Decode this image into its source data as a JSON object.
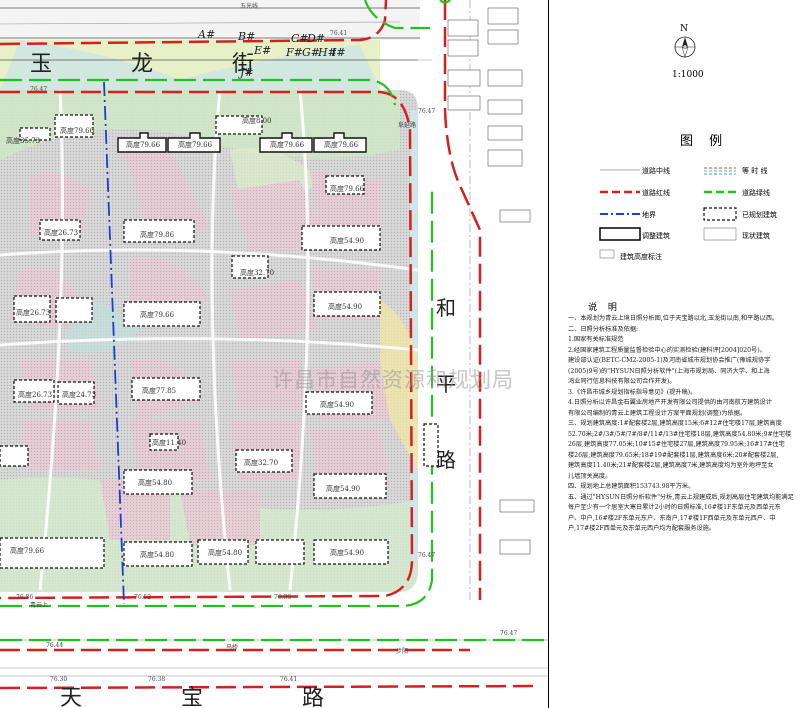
{
  "map": {
    "roads": {
      "yulong": "玉 龙 街",
      "tianbao": "天 宝 路",
      "heping": "和 平 路",
      "wuguang": "五光线",
      "qingyun": "青云上",
      "fuyan": "阜延路",
      "maqiao": "马桥",
      "yuyan": "步阳"
    },
    "building_letters": [
      "A#",
      "B#",
      "C#",
      "D#",
      "E#",
      "F#",
      "G#",
      "H#",
      "I#",
      "J#"
    ],
    "building_heights": {
      "b1": "高度79.66",
      "b2": "高度79.66",
      "b3": "高度79.66",
      "b4": "高度79.66",
      "b5": "高度35.73",
      "b6": "高度8.00",
      "b7": "高度79.66",
      "b8": "高度79.86",
      "b9": "高度54.90",
      "b10": "高度32.70",
      "b11": "高度26.73",
      "b12": "高度79.66",
      "b13": "高度79.66",
      "b14": "高度54.90",
      "b15": "高度26.73",
      "b16": "高度77.85",
      "b17": "高度54.90",
      "b18": "高度32.70",
      "b19": "高度54.90",
      "b20": "高度26.73",
      "b21": "高度54.80",
      "b22": "高度54.90",
      "b23": "高度54.80",
      "b24": "高度79.66",
      "b25": "高度24.73",
      "b26": "高度54.80",
      "b27": "高度11.40"
    },
    "elevations": [
      "76.47",
      "76.86",
      "76.52",
      "76.36",
      "76.44",
      "76.38",
      "76.41",
      "76.30",
      "76.47",
      "76.47",
      "76.41",
      "76.47"
    ],
    "watermark": "许昌市自然资源和规划局"
  },
  "legend": {
    "north": "N",
    "scale": "1:1000",
    "title": "图 例",
    "items": {
      "road_center": "道路中线",
      "contour": "等 时 线",
      "road_red": "道路红线",
      "road_green": "道路绿线",
      "boundary": "地界",
      "planned": "已规划建筑",
      "adjusted": "调整建筑",
      "existing": "现状建筑",
      "height_note": "建筑高度标注"
    }
  },
  "notes": {
    "title": "说 明",
    "lines": [
      "一、本规划为青云上境日照分析图,位于天宝路以北,玉龙街以南,和平路以西。",
      "二、日照分析标准及依据:",
      "1.国家有关标准规范",
      "2.经国家建筑工程质量监督检验中心的实测检验(建科评[2004]020号)。",
      "建设部认证(BETC-CM2-2005-1)及河南省城市规划协会推广(豫城规协字",
      "(2005)9号)的\"HYSUN日照分析软件\"(上海市规划局、同济大学、和上海",
      "鸿业同行信息科技有限公司合作开发)。",
      "3.《许昌市城乡规划指标指导意见》(提升稿)。",
      "4.日照分析以许昌金石翼业房地产开发有限公司提供的由河南航方建筑设计",
      "有限公司编制的青云上建筑工程设计方案平面规划(调整)为依据。",
      "三、规划建筑高度:1#配套楼2层,建筑高度15米;6#12#住宅楼17层,建筑高度",
      "52.70米;2#/3#/5#/7#/8#/11#/13#住宅楼18层,建筑高度54.80米;9#住宅楼",
      "26层,建筑高度77.05米;10#15#住宅楼27层,建筑高度79.95米;16#17#住宅",
      "楼26层,建筑高度79.65米;18#19#配套楼1层,建筑高度6米;20#配套楼2层,",
      "建筑高度11.40米;21#配套楼2层,建筑高度7米,建筑高度均为室外地坪至女",
      "儿墙顶关高度。",
      "四、规划地上总建筑面积153743.98平方米。",
      "五、通过\"HYSUN日照分析软件\"分析,青云上规建成后,规划高层住宅建筑均能满足",
      "每户至少有一个居室大寒日累计2小时的日照标准,16#楼1F东单元及西单元东",
      "户、中户,16#楼2F东单元东户、东南户,17#楼1F西单元及东单元西户、中",
      "户,17#楼2F西单元及东单元西户均为配套服务设施。"
    ]
  }
}
